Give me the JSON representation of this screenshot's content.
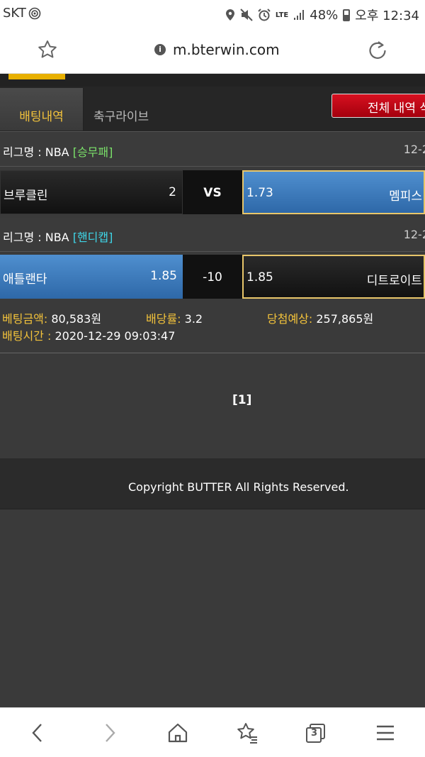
{
  "status_bar": {
    "carrier": "SKT",
    "lte": "LTE",
    "battery": "48%",
    "time": "오후 12:34"
  },
  "browser": {
    "url": "m.bterwin.com",
    "tab_count": "3"
  },
  "tabs": {
    "active": "배팅내역",
    "soccer": "축구라이브",
    "all_history": "전체 내역 삭"
  },
  "bets": [
    {
      "league_label": "리그명 : NBA",
      "league_tag": "[승무패]",
      "date": "12-2",
      "home": "브루클린",
      "home_odds": "2",
      "middle": "VS",
      "away_odds": "1.73",
      "away": "멤피스"
    },
    {
      "league_label": "리그명 : NBA",
      "league_tag": "[핸디캡]",
      "date": "12-2",
      "home": "애틀랜타",
      "home_odds": "1.85",
      "middle": "-10",
      "away_odds": "1.85",
      "away": "디트로이트"
    }
  ],
  "summary": {
    "amount_label": "베팅금액:",
    "amount": "80,583원",
    "rate_label": "배당률:",
    "rate": "3.2",
    "expected_label": "당첨예상:",
    "expected": "257,865원",
    "time_label": "배팅시간 :",
    "time": "2020-12-29 09:03:47"
  },
  "pagination": "[1]",
  "footer": "Copyright BUTTER All Rights Reserved.",
  "colors": {
    "accent_yellow": "#f2c23b",
    "selected_blue": "#3c7bbd",
    "danger_red": "#c40014",
    "tag_green": "#7be26a",
    "tag_cyan": "#3fd6e8"
  }
}
